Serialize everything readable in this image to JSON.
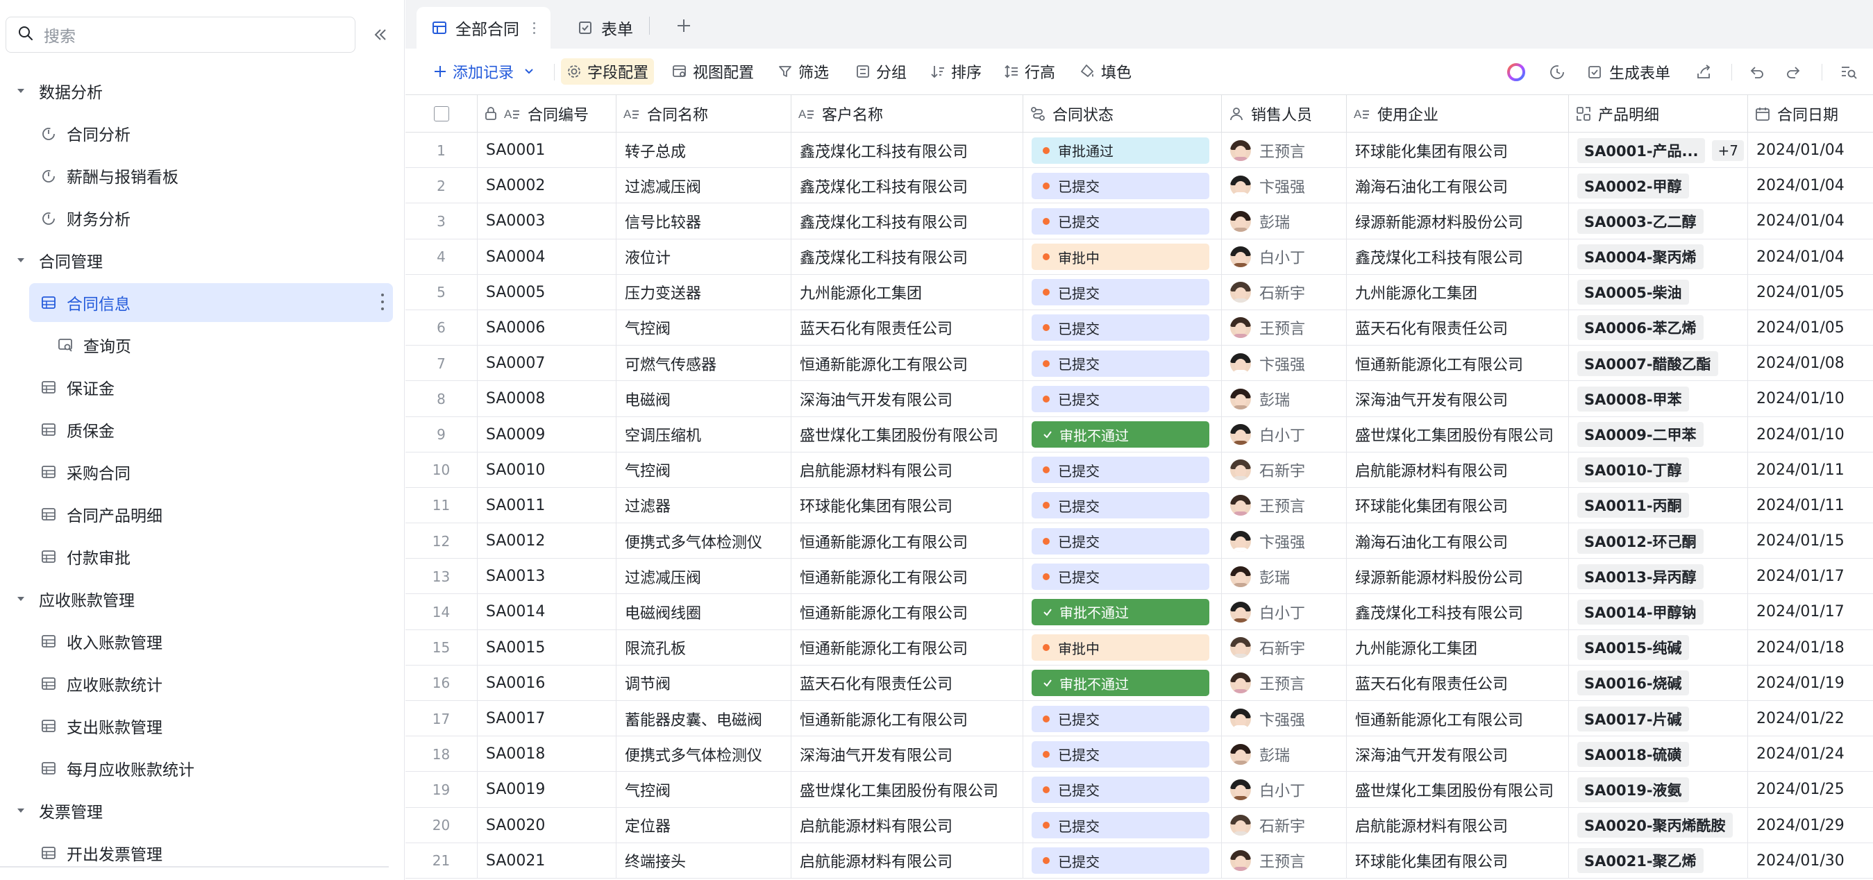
{
  "sidebar": {
    "search_placeholder": "搜索",
    "groups": [
      {
        "label": "数据分析",
        "items": [
          {
            "label": "合同分析",
            "icon": "dashboard-icon"
          },
          {
            "label": "薪酬与报销看板",
            "icon": "dashboard-icon"
          },
          {
            "label": "财务分析",
            "icon": "dashboard-icon"
          }
        ]
      },
      {
        "label": "合同管理",
        "items": [
          {
            "label": "合同信息",
            "icon": "table-icon",
            "active": true
          },
          {
            "label": "查询页",
            "icon": "query-page-icon",
            "sub": true
          },
          {
            "label": "保证金",
            "icon": "table-icon"
          },
          {
            "label": "质保金",
            "icon": "table-icon"
          },
          {
            "label": "采购合同",
            "icon": "table-icon"
          },
          {
            "label": "合同产品明细",
            "icon": "table-icon"
          },
          {
            "label": "付款审批",
            "icon": "table-icon"
          }
        ]
      },
      {
        "label": "应收账款管理",
        "items": [
          {
            "label": "收入账款管理",
            "icon": "table-icon"
          },
          {
            "label": "应收账款统计",
            "icon": "table-icon"
          },
          {
            "label": "支出账款管理",
            "icon": "table-icon"
          },
          {
            "label": "每月应收账款统计",
            "icon": "table-icon"
          }
        ]
      },
      {
        "label": "发票管理",
        "items": [
          {
            "label": "开出发票管理",
            "icon": "table-icon"
          }
        ]
      }
    ]
  },
  "tabs": [
    {
      "label": "全部合同",
      "active": true
    },
    {
      "label": "表单",
      "active": false
    }
  ],
  "toolbar": {
    "add_record": "添加记录",
    "field_config": "字段配置",
    "view_config": "视图配置",
    "filter": "筛选",
    "group": "分组",
    "sort": "排序",
    "row_height": "行高",
    "fill_color": "填色",
    "generate_form": "生成表单"
  },
  "columns": [
    "合同编号",
    "合同名称",
    "客户名称",
    "合同状态",
    "销售人员",
    "使用企业",
    "产品明细",
    "合同日期"
  ],
  "colors": {
    "accent": "#245bdb",
    "status_approved": "#d4f0f9",
    "status_submitted": "#e0e6ff",
    "status_reviewing": "#fde9d4",
    "status_rejected": "#4ea152"
  },
  "rows": [
    {
      "idx": "1",
      "id": "SA0001",
      "name": "转子总成",
      "client": "鑫茂煤化工科技有限公司",
      "status": "审批通过",
      "status_type": "approved",
      "sales": "王预言",
      "company": "环球能化集团有限公司",
      "product": "SA0001-产品...",
      "extra": "+7",
      "date": "2024/01/04"
    },
    {
      "idx": "2",
      "id": "SA0002",
      "name": "过滤减压阀",
      "client": "鑫茂煤化工科技有限公司",
      "status": "已提交",
      "status_type": "submitted",
      "sales": "卞强强",
      "company": "瀚海石油化工有限公司",
      "product": "SA0002-甲醇",
      "date": "2024/01/04"
    },
    {
      "idx": "3",
      "id": "SA0003",
      "name": "信号比较器",
      "client": "鑫茂煤化工科技有限公司",
      "status": "已提交",
      "status_type": "submitted",
      "sales": "彭瑞",
      "company": "绿源新能源材料股份公司",
      "product": "SA0003-乙二醇",
      "date": "2024/01/04"
    },
    {
      "idx": "4",
      "id": "SA0004",
      "name": "液位计",
      "client": "鑫茂煤化工科技有限公司",
      "status": "审批中",
      "status_type": "reviewing",
      "sales": "白小丁",
      "company": "鑫茂煤化工科技有限公司",
      "product": "SA0004-聚丙烯",
      "date": "2024/01/04"
    },
    {
      "idx": "5",
      "id": "SA0005",
      "name": "压力变送器",
      "client": "九州能源化工集团",
      "status": "已提交",
      "status_type": "submitted",
      "sales": "石新宇",
      "company": "九州能源化工集团",
      "product": "SA0005-柴油",
      "date": "2024/01/05"
    },
    {
      "idx": "6",
      "id": "SA0006",
      "name": "气控阀",
      "client": "蓝天石化有限责任公司",
      "status": "已提交",
      "status_type": "submitted",
      "sales": "王预言",
      "company": "蓝天石化有限责任公司",
      "product": "SA0006-苯乙烯",
      "date": "2024/01/05"
    },
    {
      "idx": "7",
      "id": "SA0007",
      "name": "可燃气传感器",
      "client": "恒通新能源化工有限公司",
      "status": "已提交",
      "status_type": "submitted",
      "sales": "卞强强",
      "company": "恒通新能源化工有限公司",
      "product": "SA0007-醋酸乙酯",
      "date": "2024/01/08"
    },
    {
      "idx": "8",
      "id": "SA0008",
      "name": "电磁阀",
      "client": "深海油气开发有限公司",
      "status": "已提交",
      "status_type": "submitted",
      "sales": "彭瑞",
      "company": "深海油气开发有限公司",
      "product": "SA0008-甲苯",
      "date": "2024/01/10"
    },
    {
      "idx": "9",
      "id": "SA0009",
      "name": "空调压缩机",
      "client": "盛世煤化工集团股份有限公司",
      "status": "审批不通过",
      "status_type": "rejected",
      "sales": "白小丁",
      "company": "盛世煤化工集团股份有限公司",
      "product": "SA0009-二甲苯",
      "date": "2024/01/10"
    },
    {
      "idx": "10",
      "id": "SA0010",
      "name": "气控阀",
      "client": "启航能源材料有限公司",
      "status": "已提交",
      "status_type": "submitted",
      "sales": "石新宇",
      "company": "启航能源材料有限公司",
      "product": "SA0010-丁醇",
      "date": "2024/01/11"
    },
    {
      "idx": "11",
      "id": "SA0011",
      "name": "过滤器",
      "client": "环球能化集团有限公司",
      "status": "已提交",
      "status_type": "submitted",
      "sales": "王预言",
      "company": "环球能化集团有限公司",
      "product": "SA0011-丙酮",
      "date": "2024/01/11"
    },
    {
      "idx": "12",
      "id": "SA0012",
      "name": "便携式多气体检测仪",
      "client": "恒通新能源化工有限公司",
      "status": "已提交",
      "status_type": "submitted",
      "sales": "卞强强",
      "company": "瀚海石油化工有限公司",
      "product": "SA0012-环己酮",
      "date": "2024/01/15"
    },
    {
      "idx": "13",
      "id": "SA0013",
      "name": "过滤减压阀",
      "client": "恒通新能源化工有限公司",
      "status": "已提交",
      "status_type": "submitted",
      "sales": "彭瑞",
      "company": "绿源新能源材料股份公司",
      "product": "SA0013-异丙醇",
      "date": "2024/01/17"
    },
    {
      "idx": "14",
      "id": "SA0014",
      "name": "电磁阀线圈",
      "client": "恒通新能源化工有限公司",
      "status": "审批不通过",
      "status_type": "rejected",
      "sales": "白小丁",
      "company": "鑫茂煤化工科技有限公司",
      "product": "SA0014-甲醇钠",
      "date": "2024/01/17"
    },
    {
      "idx": "15",
      "id": "SA0015",
      "name": "限流孔板",
      "client": "恒通新能源化工有限公司",
      "status": "审批中",
      "status_type": "reviewing",
      "sales": "石新宇",
      "company": "九州能源化工集团",
      "product": "SA0015-纯碱",
      "date": "2024/01/18"
    },
    {
      "idx": "16",
      "id": "SA0016",
      "name": "调节阀",
      "client": "蓝天石化有限责任公司",
      "status": "审批不通过",
      "status_type": "rejected",
      "sales": "王预言",
      "company": "蓝天石化有限责任公司",
      "product": "SA0016-烧碱",
      "date": "2024/01/19"
    },
    {
      "idx": "17",
      "id": "SA0017",
      "name": "蓄能器皮囊、电磁阀",
      "client": "恒通新能源化工有限公司",
      "status": "已提交",
      "status_type": "submitted",
      "sales": "卞强强",
      "company": "恒通新能源化工有限公司",
      "product": "SA0017-片碱",
      "date": "2024/01/22"
    },
    {
      "idx": "18",
      "id": "SA0018",
      "name": "便携式多气体检测仪",
      "client": "深海油气开发有限公司",
      "status": "已提交",
      "status_type": "submitted",
      "sales": "彭瑞",
      "company": "深海油气开发有限公司",
      "product": "SA0018-硫磺",
      "date": "2024/01/24"
    },
    {
      "idx": "19",
      "id": "SA0019",
      "name": "气控阀",
      "client": "盛世煤化工集团股份有限公司",
      "status": "已提交",
      "status_type": "submitted",
      "sales": "白小丁",
      "company": "盛世煤化工集团股份有限公司",
      "product": "SA0019-液氨",
      "date": "2024/01/25"
    },
    {
      "idx": "20",
      "id": "SA0020",
      "name": "定位器",
      "client": "启航能源材料有限公司",
      "status": "已提交",
      "status_type": "submitted",
      "sales": "石新宇",
      "company": "启航能源材料有限公司",
      "product": "SA0020-聚丙烯酰胺",
      "date": "2024/01/29"
    },
    {
      "idx": "21",
      "id": "SA0021",
      "name": "终端接头",
      "client": "启航能源材料有限公司",
      "status": "已提交",
      "status_type": "submitted",
      "sales": "王预言",
      "company": "环球能化集团有限公司",
      "product": "SA0021-聚乙烯",
      "date": "2024/01/30"
    }
  ]
}
